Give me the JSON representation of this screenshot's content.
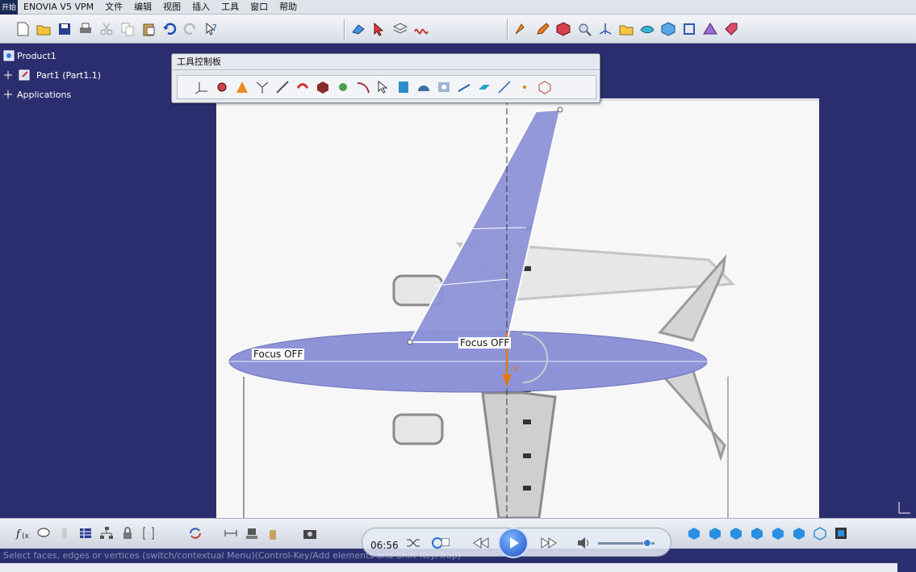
{
  "menubar": {
    "start_label": "开始",
    "items": [
      "ENOVIA V5 VPM",
      "文件",
      "编辑",
      "视图",
      "插入",
      "工具",
      "窗口",
      "帮助"
    ]
  },
  "spec_tree": {
    "root": "Product1",
    "child": "Part1 (Part1.1)",
    "applications": "Applications"
  },
  "palette": {
    "title": "工具控制板"
  },
  "viewport": {
    "focus_label_1": "Focus OFF",
    "focus_label_2": "Focus OFF",
    "axis_label": "x"
  },
  "statusbar": {
    "message": "Select faces, edges or vertices (switch/contextual Menu)(Control-Key/Add elements and Shift-Key/Trap)"
  },
  "media_player": {
    "time": "06:56"
  },
  "colors": {
    "background": "#2b2e6e",
    "surface": "#8f96d6",
    "toolbar": "#dfe3ea"
  }
}
